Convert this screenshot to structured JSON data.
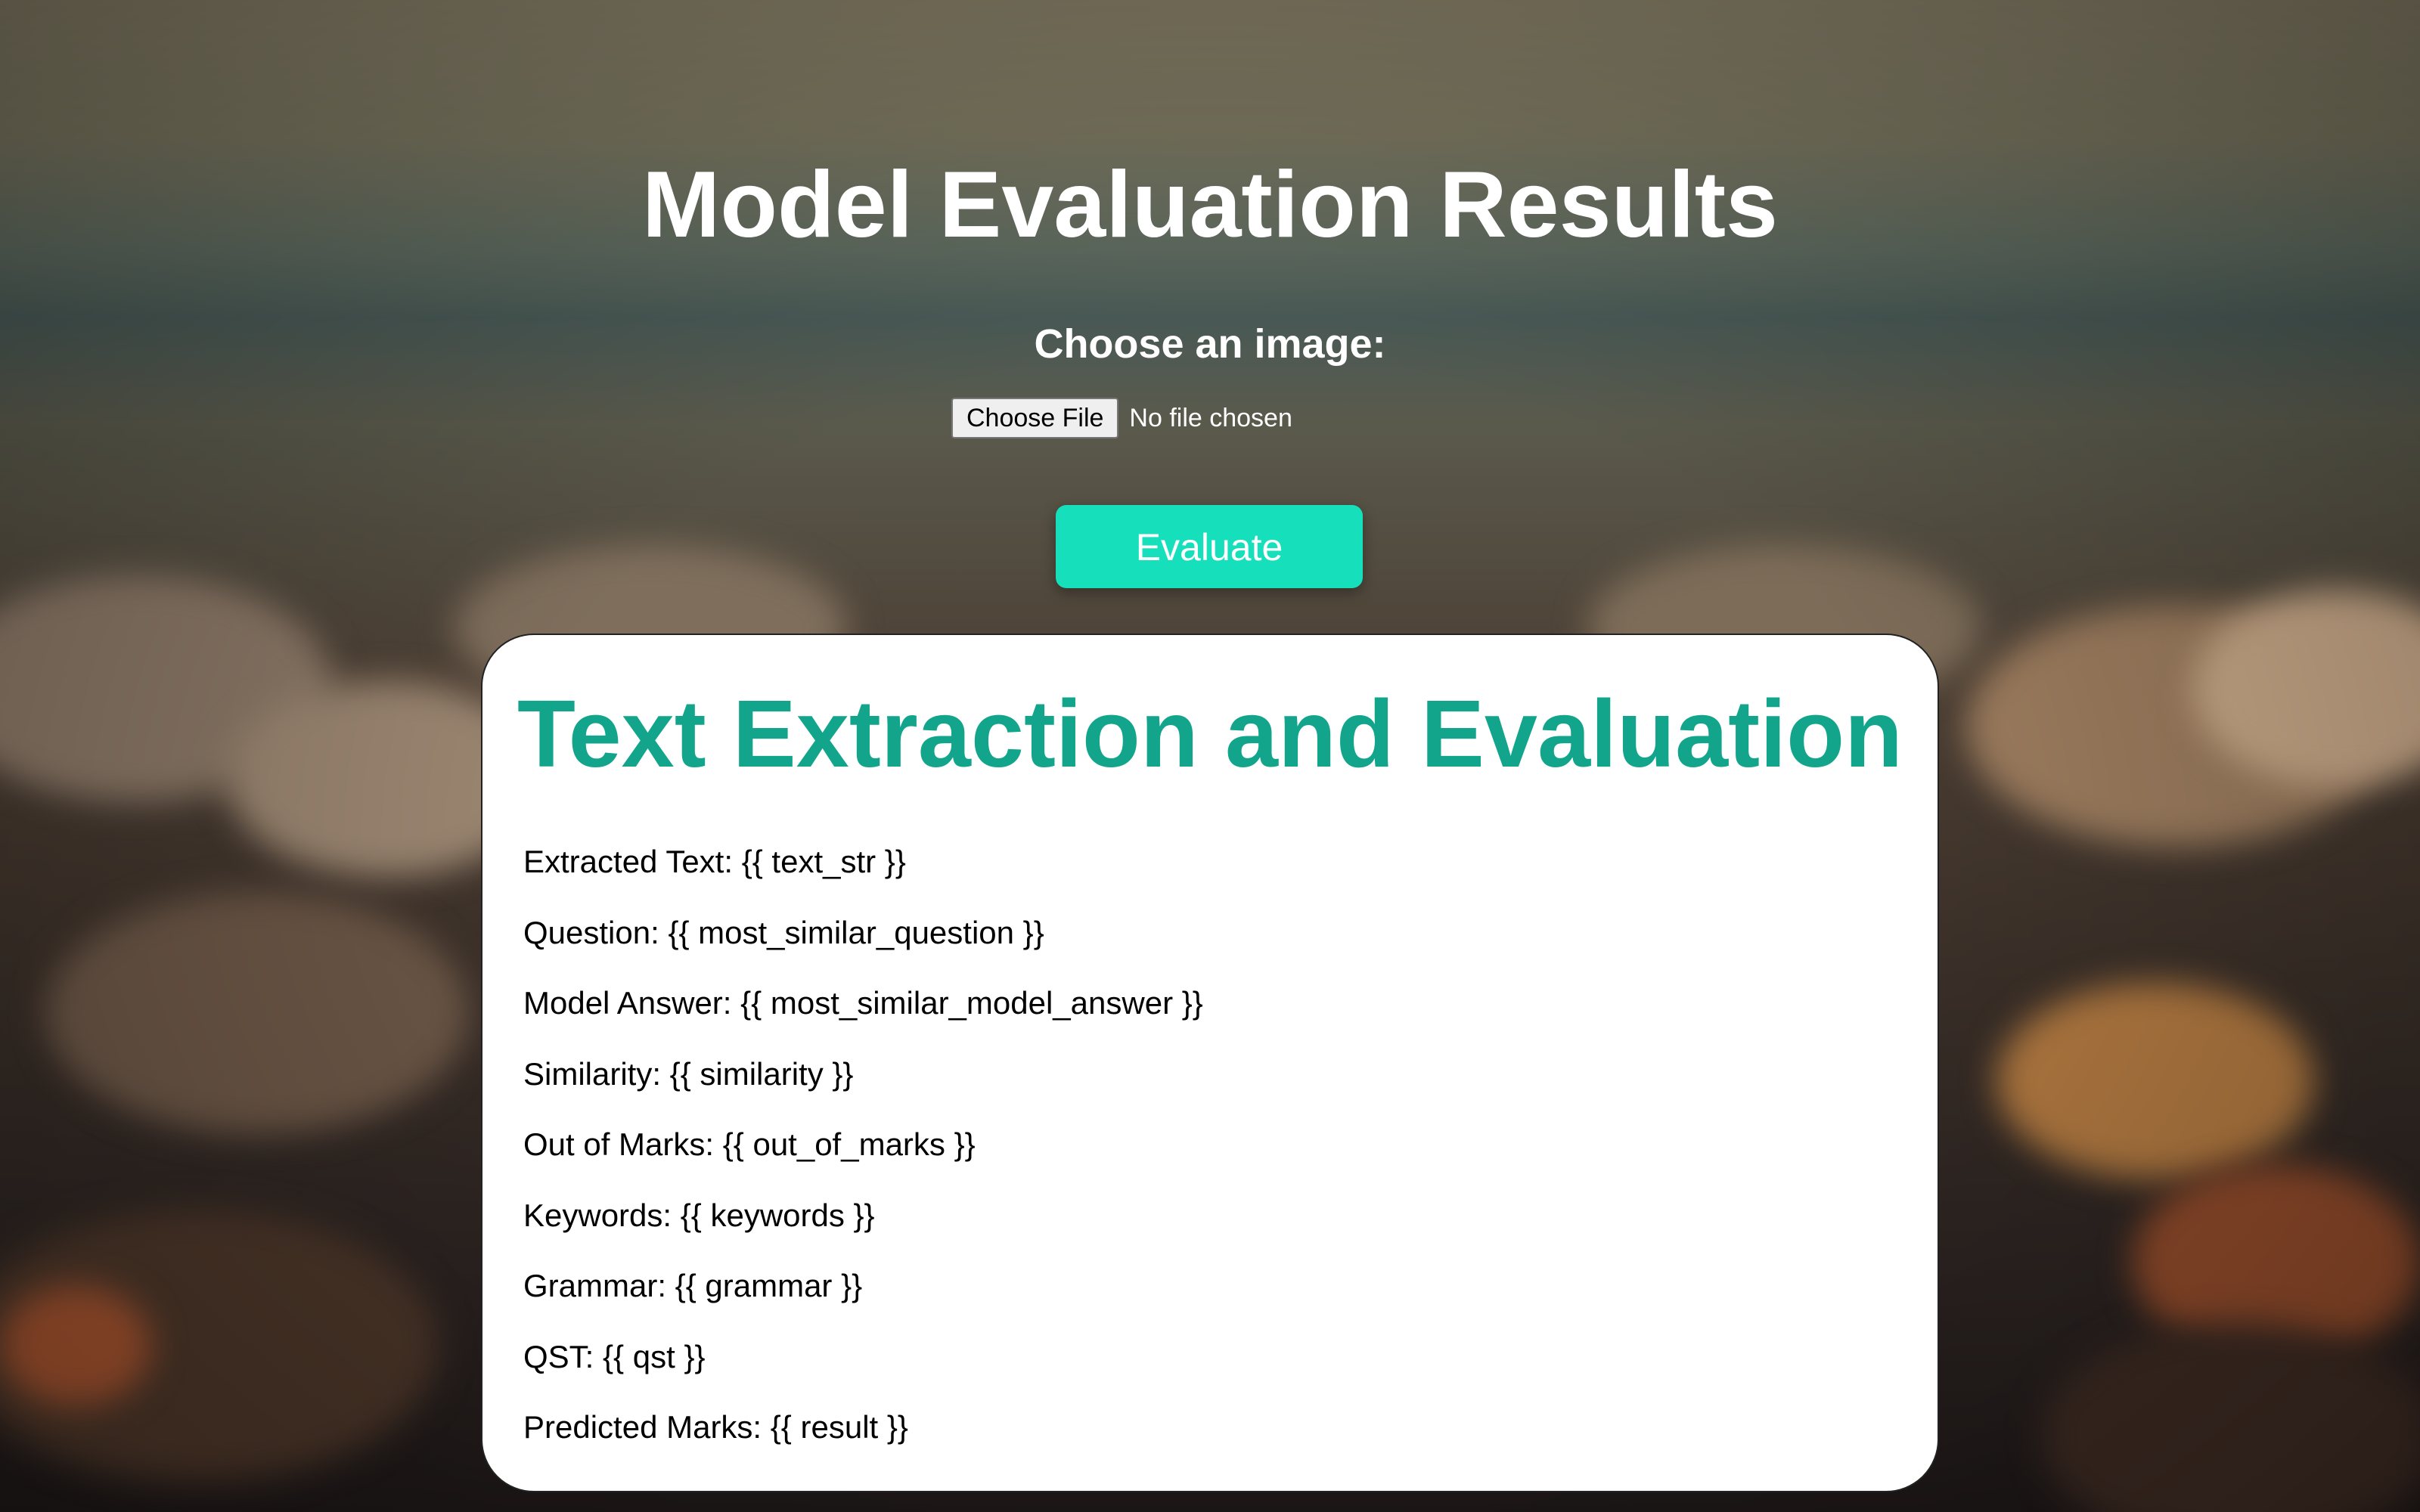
{
  "header": {
    "title": "Model Evaluation Results"
  },
  "upload": {
    "label": "Choose an image:",
    "button_label": "Choose File",
    "status_text": "No file chosen"
  },
  "actions": {
    "evaluate_label": "Evaluate"
  },
  "card": {
    "title": "Text Extraction and Evaluation",
    "lines": [
      "Extracted Text: {{ text_str }}",
      "Question: {{ most_similar_question }}",
      "Model Answer: {{ most_similar_model_answer }}",
      "Similarity: {{ similarity }}",
      "Out of Marks: {{ out_of_marks }}",
      "Keywords: {{ keywords }}",
      "Grammar: {{ grammar }}",
      "QST: {{ qst }}",
      "Predicted Marks: {{ result }}"
    ]
  },
  "colors": {
    "accent_button": "#16dfbc",
    "card_title": "#13a58c",
    "heading_text": "#ffffff"
  }
}
